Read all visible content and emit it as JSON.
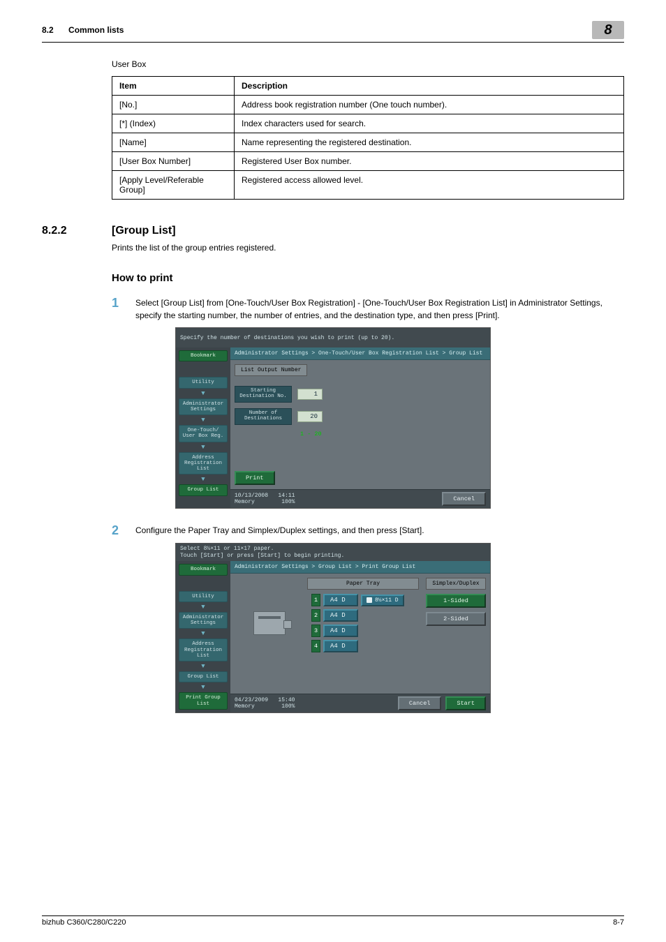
{
  "header": {
    "section_num": "8.2",
    "section_title": "Common lists",
    "chapter": "8"
  },
  "userbox_label": "User Box",
  "table": {
    "headers": [
      "Item",
      "Description"
    ],
    "rows": [
      {
        "item": "[No.]",
        "desc": "Address book registration number (One touch number)."
      },
      {
        "item": "[*] (Index)",
        "desc": "Index characters used for search."
      },
      {
        "item": "[Name]",
        "desc": "Name representing the registered destination."
      },
      {
        "item": "[User Box Number]",
        "desc": "Registered User Box number."
      },
      {
        "item": "[Apply Level/Referable Group]",
        "desc": "Registered access allowed level."
      }
    ]
  },
  "h3": {
    "num": "8.2.2",
    "title": "[Group List]"
  },
  "intro": "Prints the list of the group entries registered.",
  "howto_title": "How to print",
  "steps": {
    "s1_num": "1",
    "s1_text": "Select [Group List] from [One-Touch/User Box Registration] - [One-Touch/User Box Registration List] in Administrator Settings, specify the starting number, the number of entries, and the destination type, and then press [Print].",
    "s2_num": "2",
    "s2_text": "Configure the Paper Tray and Simplex/Duplex settings, and then press [Start]."
  },
  "panel1": {
    "top": "Specify the number of destinations you wish to print (up to 20).",
    "sidebar": [
      "Bookmark",
      "Utility",
      "Administrator Settings",
      "One-Touch/ User Box Reg.",
      "Address Registration List",
      "Group List"
    ],
    "breadcrumb": "Administrator Settings > One-Touch/User Box Registration List > Group List",
    "tab": "List Output Number",
    "field1_label": "Starting Destination No.",
    "field1_value": "1",
    "field2_label": "Number of Destinations",
    "field2_value": "20",
    "range": "1  -  20",
    "print": "Print",
    "cancel": "Cancel",
    "status_left": "10/13/2008   14:11\nMemory        100%"
  },
  "panel2": {
    "top": "Select 8½×11 or 11×17 paper.\nTouch [Start] or press [Start] to begin printing.",
    "sidebar": [
      "Bookmark",
      "Utility",
      "Administrator Settings",
      "Address Registration List",
      "Group List",
      "Print Group List"
    ],
    "breadcrumb": "Administrator Settings > Group List > Print Group List",
    "col_paper": "Paper Tray",
    "col_sd": "Simplex/Duplex",
    "trays": [
      {
        "n": "1",
        "label": "A4 D"
      },
      {
        "n": "2",
        "label": "A4 D"
      },
      {
        "n": "3",
        "label": "A4 D"
      },
      {
        "n": "4",
        "label": "A4 D"
      }
    ],
    "tray_extra": "8½×11 D",
    "sd1": "1-Sided",
    "sd2": "2-Sided",
    "cancel": "Cancel",
    "start": "Start",
    "status_left": "04/23/2009   15:40\nMemory        100%"
  },
  "footer": {
    "left": "bizhub C360/C280/C220",
    "right": "8-7"
  }
}
